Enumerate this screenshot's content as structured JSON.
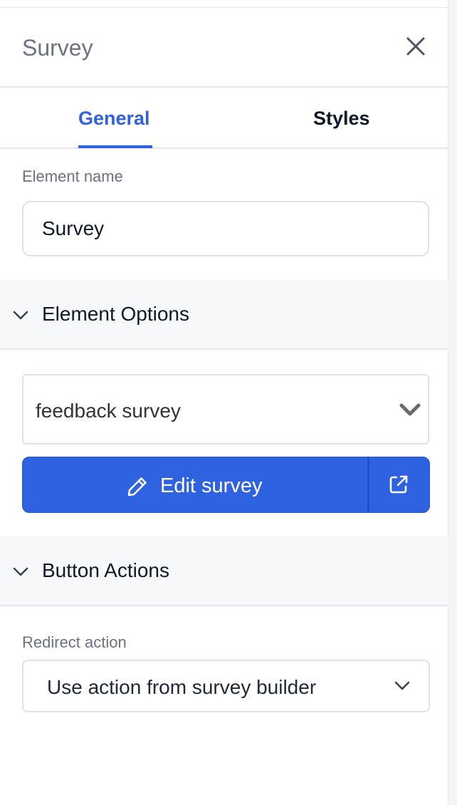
{
  "panel": {
    "title": "Survey"
  },
  "tabs": [
    {
      "label": "General",
      "active": true
    },
    {
      "label": "Styles",
      "active": false
    }
  ],
  "element_name": {
    "label": "Element name",
    "value": "Survey"
  },
  "sections": {
    "element_options": {
      "title": "Element Options",
      "expanded": true,
      "survey_select": {
        "selected": "feedback survey"
      },
      "edit_button": {
        "label": "Edit survey"
      }
    },
    "button_actions": {
      "title": "Button Actions",
      "expanded": true,
      "redirect": {
        "label": "Redirect action",
        "selected": "Use action from survey builder"
      }
    }
  },
  "icons": {
    "close": "close-icon",
    "chevron": "chevron-down-icon",
    "pencil": "pencil-icon",
    "external": "external-link-icon"
  },
  "colors": {
    "accent": "#2f62e0",
    "section_bg": "#f7f8fa",
    "muted_text": "#6b7280"
  }
}
